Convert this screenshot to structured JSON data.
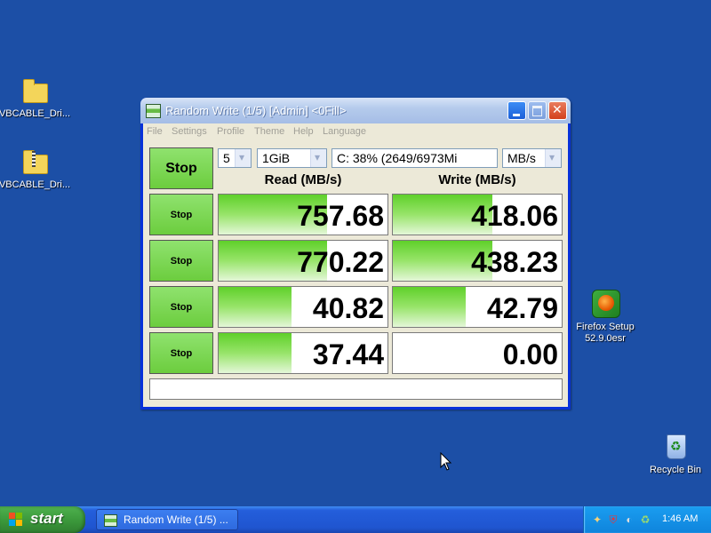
{
  "desktop": {
    "icons": [
      {
        "label": "VBCABLE_Dri...",
        "icon": "folder-icon"
      },
      {
        "label": "VBCABLE_Dri...",
        "icon": "zip-folder-icon"
      },
      {
        "label": "Firefox Setup\n52.9.0esr",
        "line1": "Firefox Setup",
        "line2": "52.9.0esr",
        "icon": "firefox-setup-icon"
      },
      {
        "label": "Recycle Bin",
        "icon": "recycle-bin-icon"
      }
    ]
  },
  "window": {
    "title": "Random Write (1/5) [Admin] <0Fill>",
    "menu": [
      "File",
      "Settings",
      "Profile",
      "Theme",
      "Help",
      "Language"
    ],
    "stop_all_label": "Stop",
    "count_value": "5",
    "size_value": "1GiB",
    "drive_value": "C: 38% (2649/6973Mi",
    "unit_value": "MB/s",
    "read_header": "Read (MB/s)",
    "write_header": "Write (MB/s)",
    "rows": [
      {
        "stop_label": "Stop",
        "read": "757.68",
        "write": "418.06",
        "read_level": 0.64,
        "write_level": 0.59
      },
      {
        "stop_label": "Stop",
        "read": "770.22",
        "write": "438.23",
        "read_level": 0.64,
        "write_level": 0.59
      },
      {
        "stop_label": "Stop",
        "read": "40.82",
        "write": "42.79",
        "read_level": 0.43,
        "write_level": 0.43
      },
      {
        "stop_label": "Stop",
        "read": "37.44",
        "write": "0.00",
        "read_level": 0.43,
        "write_level": 0.0
      }
    ],
    "status_text": ""
  },
  "taskbar": {
    "start_label": "start",
    "task_label": "Random Write (1/5) ...",
    "clock": "1:46 AM"
  },
  "colors": {
    "desktop": "#1c4fa6",
    "meter_green": "#5fd02a",
    "button_green": "#6ccd3e"
  }
}
